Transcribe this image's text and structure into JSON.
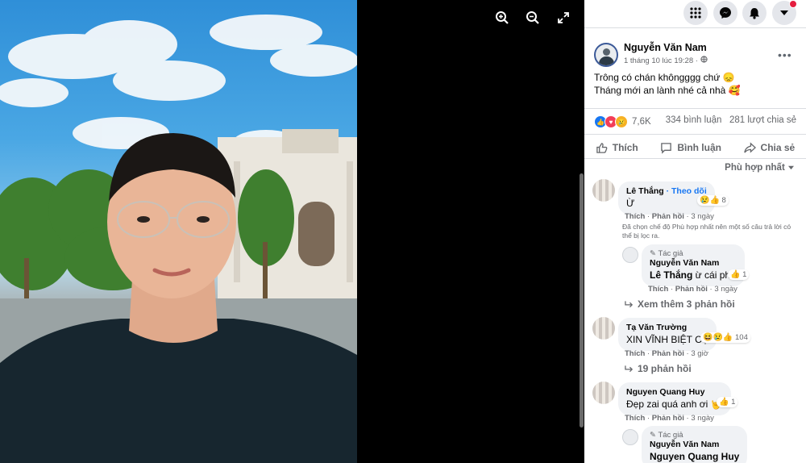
{
  "viewer": {
    "zoom_in_icon": "zoom-in-icon",
    "zoom_out_icon": "zoom-out-icon",
    "fullscreen_icon": "fullscreen-icon"
  },
  "topbar": {
    "icons": [
      "menu-grid-icon",
      "messenger-icon",
      "bell-icon",
      "caret-down-icon"
    ],
    "notification_dot_color": "#e41e3f"
  },
  "post": {
    "author": "Nguyễn Văn Nam",
    "time": "1 tháng 10 lúc 19:28 · ",
    "text_line1": "Trông có chán khôngggg chứ 😞",
    "text_line2": "Tháng mới an lành nhé cả nhà 🥰",
    "reaction_count": "7,6K",
    "comment_count": "334 bình luận",
    "share_count": "281 lượt chia sẻ"
  },
  "actions": {
    "like": "Thích",
    "comment": "Bình luận",
    "share": "Chia sẻ"
  },
  "sort_label": "Phù hợp nhất",
  "comments": [
    {
      "name": "Lê Thắng",
      "follow": " · Theo dõi",
      "text": "Ừ",
      "reactions": "8",
      "like": "Thích",
      "reply": "Phản hồi",
      "time": "3 ngày"
    },
    {
      "name": "Tạ Văn Trường",
      "text": "XIN VĨNH BIỆT CỤ",
      "reactions": "104",
      "like": "Thích",
      "reply": "Phản hồi",
      "time": "3 giờ"
    },
    {
      "name": "Nguyen Quang Huy",
      "text": "Đẹp zai quá anh ơi 🤟",
      "reactions": "1",
      "like": "Thích",
      "reply": "Phản hồi",
      "time": "3 ngày"
    }
  ],
  "filter_note": "Đã chọn chế độ Phù hợp nhất nên một số câu trả lời có thể bị lọc ra.",
  "replies": [
    {
      "author_badge": "Tác giả",
      "name": "Nguyễn Văn Nam",
      "mention": "Lê Thắng",
      "text": " ừ cái phừ",
      "reactions": "1",
      "like": "Thích",
      "reply": "Phản hồi",
      "time": "3 ngày"
    },
    {
      "author_badge": "Tác giả",
      "name": "Nguyễn Văn Nam",
      "mention": "Nguyen Quang Huy"
    }
  ],
  "see_more_replies": "Xem thêm 3 phản hồi",
  "replies_19": "19 phản hồi"
}
